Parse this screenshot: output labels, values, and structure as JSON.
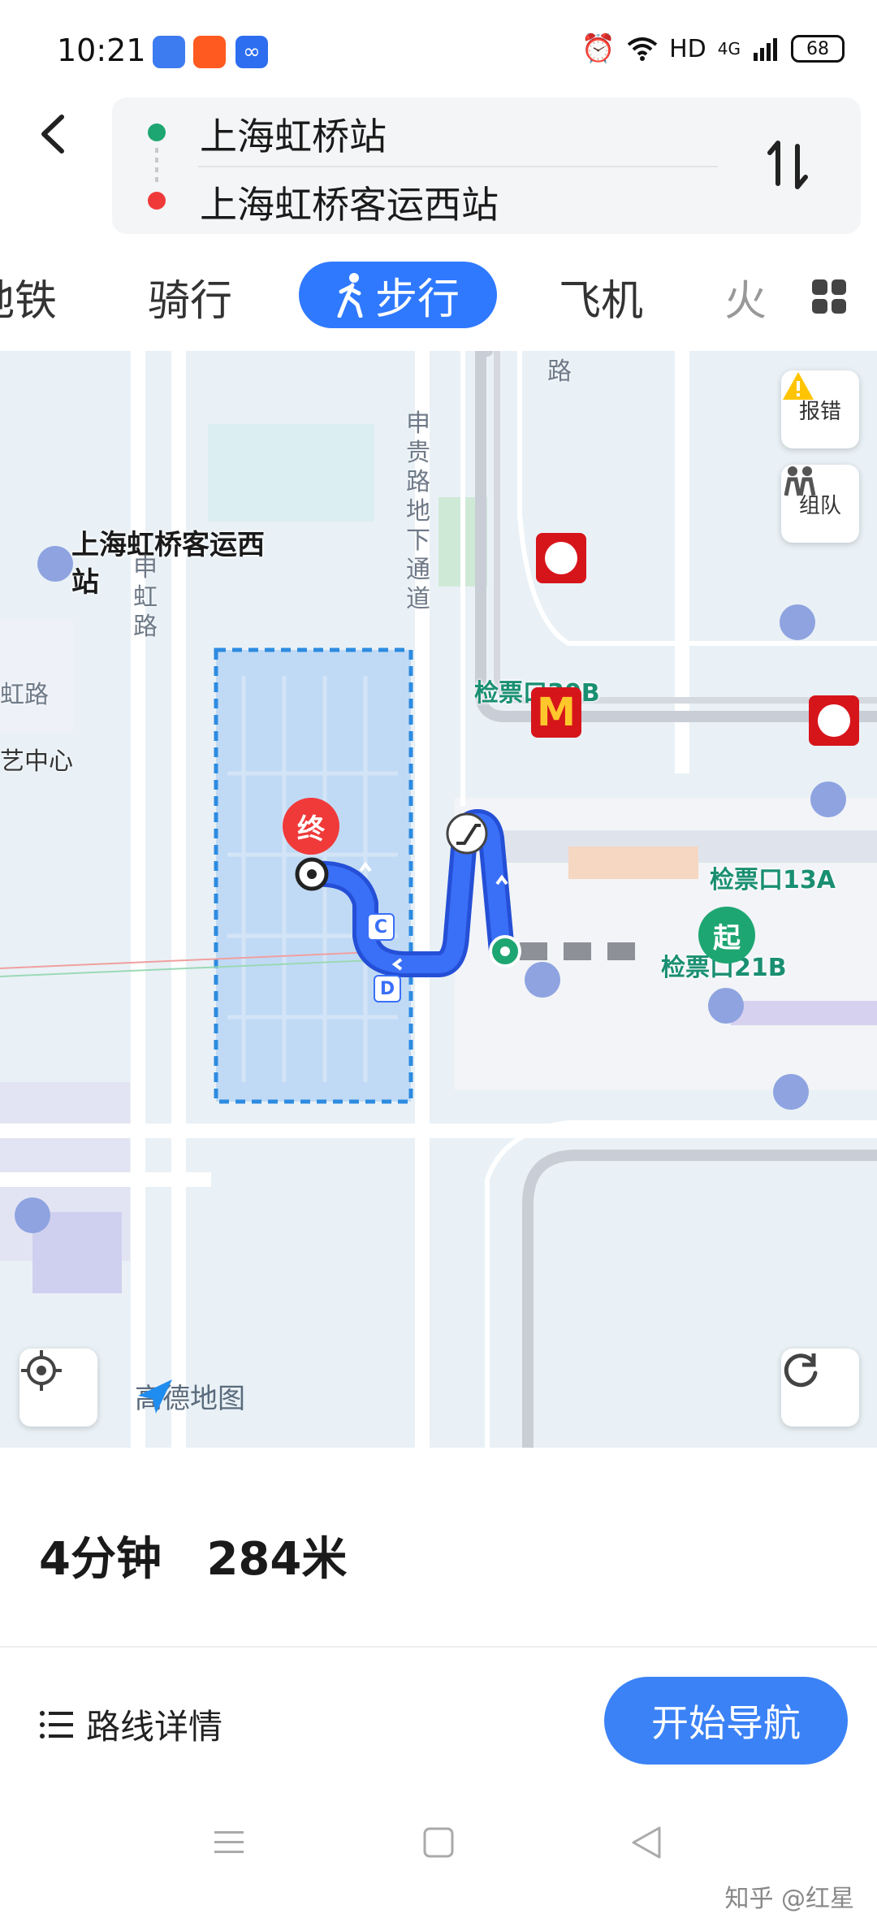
{
  "status": {
    "time": "10:21",
    "network": "HD",
    "signal": "4G",
    "battery": "68"
  },
  "route": {
    "origin": "上海虹桥站",
    "destination": "上海虹桥客运西站"
  },
  "tabs": [
    {
      "label": "地铁"
    },
    {
      "label": "骑行"
    },
    {
      "label": "步行",
      "active": true
    },
    {
      "label": "飞机"
    },
    {
      "label": "火"
    }
  ],
  "map": {
    "report_label": "报错",
    "group_label": "组队",
    "destination_pin": "终",
    "origin_pin": "起",
    "destination_name": "上海虹桥客运西站",
    "road_zhonghong": "申虹路",
    "road_shengui": "申贵路地下通道",
    "road_hong": "虹路",
    "art_center": "艺中心",
    "road_lu": "路",
    "gate_13a": "检票口13A",
    "gate_21b": "检票口21B",
    "gate_30b": "检票口30B",
    "exit_c": "C",
    "exit_d": "D",
    "brand_logo": "高德地图",
    "colors": {
      "route": "#3a6ff7",
      "origin": "#1ea672",
      "destination": "#f03a3a",
      "tab_active": "#2f79ff"
    }
  },
  "summary": {
    "duration": "4分钟",
    "distance": "284米"
  },
  "actions": {
    "details_label": "路线详情",
    "navigate_label": "开始导航"
  },
  "watermark": "知乎 @红星"
}
